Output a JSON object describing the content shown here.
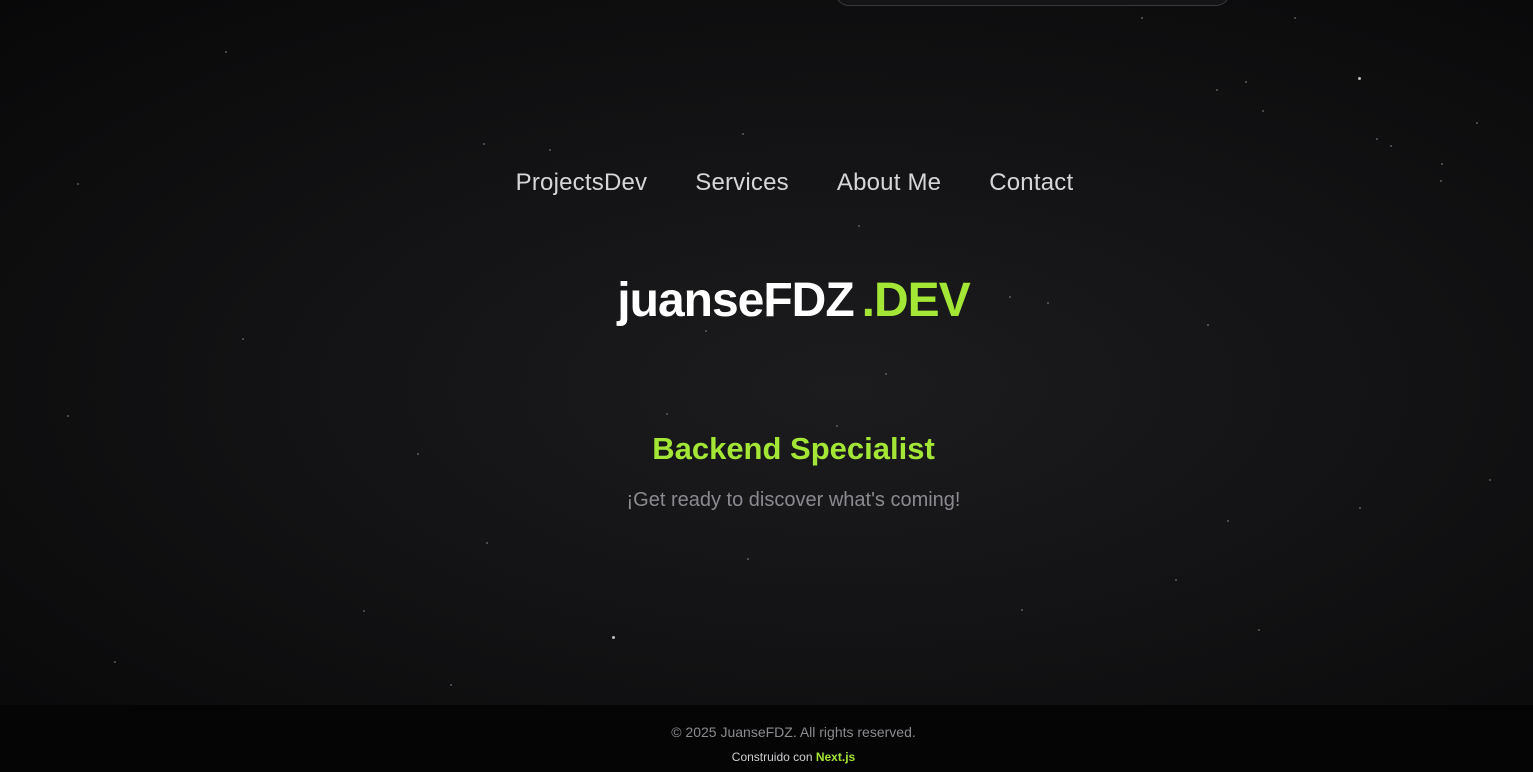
{
  "nav": {
    "items": [
      {
        "label": "ProjectsDev"
      },
      {
        "label": "Services"
      },
      {
        "label": "About Me"
      },
      {
        "label": "Contact"
      }
    ]
  },
  "hero": {
    "brand_name": "juanseFDZ",
    "brand_tld": ".DEV",
    "role": "Backend Specialist",
    "tagline": "¡Get ready to discover what's coming!"
  },
  "footer": {
    "copyright": "© 2025 JuanseFDZ. All rights reserved.",
    "built_prefix": "Construido con",
    "built_tech": "Next.js"
  },
  "colors": {
    "accent": "#a3e635",
    "background": "#0b0b0c",
    "nav_text": "#d6d6da",
    "muted_text": "#8a8a90"
  }
}
